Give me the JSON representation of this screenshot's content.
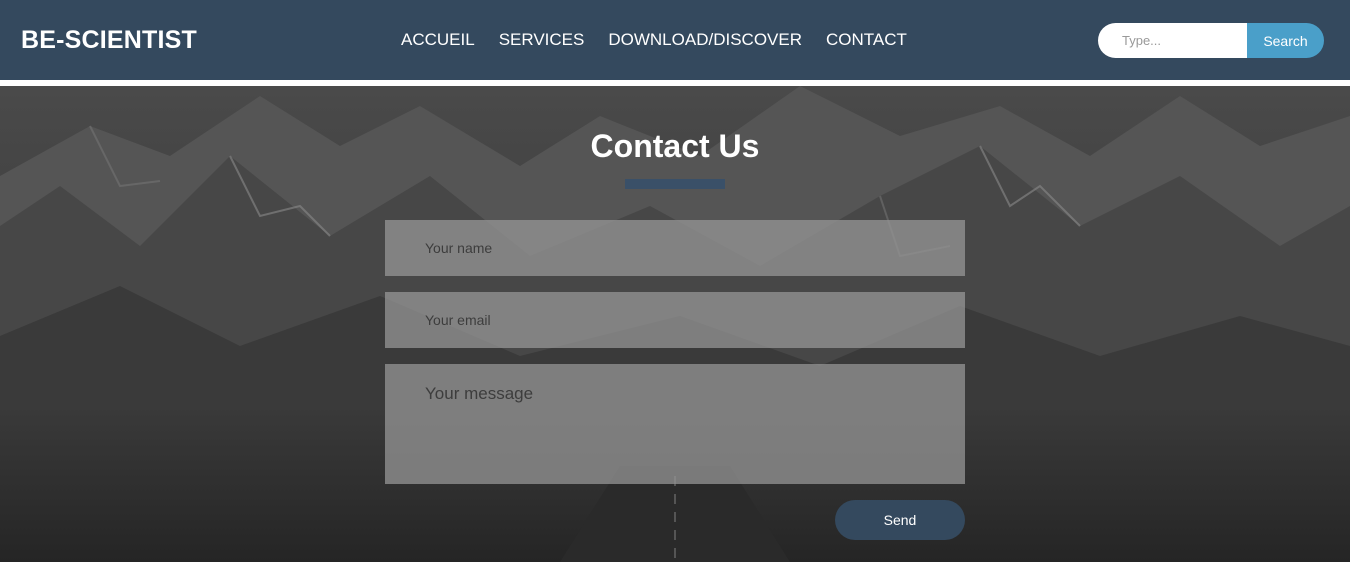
{
  "header": {
    "brand": "BE-SCIENTIST",
    "nav": [
      "ACCUEIL",
      "SERVICES",
      "DOWNLOAD/DISCOVER",
      "CONTACT"
    ],
    "search": {
      "placeholder": "Type...",
      "button_label": "Search"
    }
  },
  "contact": {
    "title": "Contact Us",
    "name_placeholder": "Your name",
    "email_placeholder": "Your email",
    "message_placeholder": "Your message",
    "send_label": "Send"
  },
  "colors": {
    "nav_bg": "#34495e",
    "search_button": "#4a9fc9",
    "send_button": "#34495e",
    "title_underline": "#3a5068"
  }
}
